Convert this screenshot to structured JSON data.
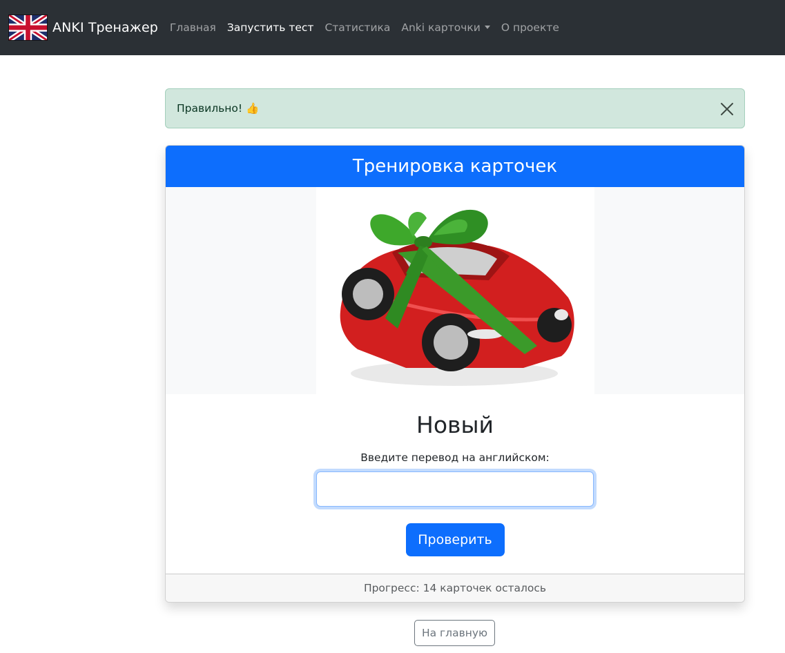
{
  "navbar": {
    "brand": "ANKI Тренажер",
    "links": [
      {
        "label": "Главная"
      },
      {
        "label": "Запустить тест"
      },
      {
        "label": "Статистика"
      },
      {
        "label": "Anki карточки"
      },
      {
        "label": "О проекте"
      }
    ]
  },
  "alert": {
    "text": "Правильно! 👍",
    "status_color": "#d1e7dd"
  },
  "card": {
    "header": "Тренировка карточек",
    "header_color": "#0d6efd",
    "word": "Новый",
    "prompt": "Введите перевод на английском:",
    "input_value": "",
    "submit_label": "Проверить",
    "progress": "Прогресс: 14 карточек осталось"
  },
  "home_button": "На главную",
  "icons": {
    "brand": "uk-flag-icon",
    "dropdown": "caret-down-icon",
    "close": "close-icon",
    "card_image": "red-car-with-green-bow-image"
  }
}
